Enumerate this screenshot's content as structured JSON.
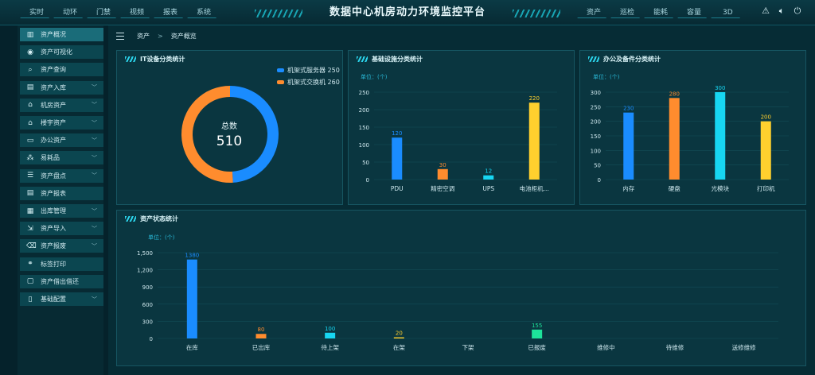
{
  "header": {
    "title": "数据中心机房动力环境监控平台",
    "nav_left": [
      "实时",
      "动环",
      "门禁",
      "视频",
      "报表",
      "系统"
    ],
    "nav_right": [
      "资产",
      "巡检",
      "能耗",
      "容量",
      "3D"
    ]
  },
  "sidebar": {
    "items": [
      {
        "label": "资产概况",
        "icon": "chart-bar-icon",
        "expandable": false,
        "active": true
      },
      {
        "label": "资产可视化",
        "icon": "eye-icon",
        "expandable": false
      },
      {
        "label": "资产查询",
        "icon": "search-icon",
        "expandable": false
      },
      {
        "label": "资产入库",
        "icon": "doc-icon",
        "expandable": true
      },
      {
        "label": "机房资产",
        "icon": "building-icon",
        "expandable": true
      },
      {
        "label": "楼宇资产",
        "icon": "building-icon",
        "expandable": true
      },
      {
        "label": "办公资产",
        "icon": "monitor-icon",
        "expandable": true
      },
      {
        "label": "易耗品",
        "icon": "nodes-icon",
        "expandable": true
      },
      {
        "label": "资产盘点",
        "icon": "list-icon",
        "expandable": true
      },
      {
        "label": "资产报表",
        "icon": "doc-icon",
        "expandable": false
      },
      {
        "label": "出库管理",
        "icon": "calendar-icon",
        "expandable": true
      },
      {
        "label": "资产导入",
        "icon": "import-icon",
        "expandable": true
      },
      {
        "label": "资产报废",
        "icon": "trash-icon",
        "expandable": true
      },
      {
        "label": "标签打印",
        "icon": "link-icon",
        "expandable": false
      },
      {
        "label": "资产借出借还",
        "icon": "chat-icon",
        "expandable": false
      },
      {
        "label": "基础配置",
        "icon": "book-icon",
        "expandable": true
      }
    ]
  },
  "breadcrumb": {
    "root": "资产",
    "sep": ">",
    "current": "资产概览"
  },
  "panels": {
    "it": {
      "title": "IT设备分类统计"
    },
    "infra": {
      "title": "基础设施分类统计",
      "unit": "单位：(个)"
    },
    "office": {
      "title": "办公及备件分类统计",
      "unit": "单位：(个)"
    },
    "status": {
      "title": "资产状态统计",
      "unit": "单位：(个)"
    }
  },
  "donut": {
    "center_label": "总数",
    "center_value": "510",
    "legend": [
      "机架式服务器 250",
      "机架式交换机 260"
    ]
  },
  "colors": {
    "blue": "#1a8cff",
    "orange": "#ff8c2e",
    "cyan": "#17d6f2",
    "yellow": "#ffd02e",
    "green": "#1de39a"
  },
  "chart_data": [
    {
      "type": "pie",
      "title": "IT设备分类统计",
      "categories": [
        "机架式服务器",
        "机架式交换机"
      ],
      "values": [
        250,
        260
      ],
      "colors": [
        "#1a8cff",
        "#ff8c2e"
      ]
    },
    {
      "type": "bar",
      "title": "基础设施分类统计",
      "categories": [
        "PDU",
        "精密空调",
        "UPS",
        "电池柜机..."
      ],
      "values": [
        120,
        30,
        12,
        220
      ],
      "colors": [
        "#1a8cff",
        "#ff8c2e",
        "#17d6f2",
        "#ffd02e"
      ],
      "ylim": [
        0,
        250
      ],
      "yticks": [
        0,
        50,
        100,
        150,
        200,
        250
      ]
    },
    {
      "type": "bar",
      "title": "办公及备件分类统计",
      "categories": [
        "内存",
        "硬盘",
        "光模块",
        "打印机"
      ],
      "values": [
        230,
        280,
        300,
        200
      ],
      "colors": [
        "#1a8cff",
        "#ff8c2e",
        "#17d6f2",
        "#ffd02e"
      ],
      "ylim": [
        0,
        300
      ],
      "yticks": [
        0,
        50,
        100,
        150,
        200,
        250,
        300
      ]
    },
    {
      "type": "bar",
      "title": "资产状态统计",
      "categories": [
        "在库",
        "已出库",
        "待上架",
        "在架",
        "下架",
        "已报废",
        "维修中",
        "待维修",
        "送修维修"
      ],
      "values": [
        1380,
        80,
        100,
        20,
        0,
        155,
        0,
        0,
        0
      ],
      "labels": [
        "1380",
        "80",
        "100",
        "20",
        "",
        "155",
        "",
        "",
        ""
      ],
      "colors": [
        "#1a8cff",
        "#ff8c2e",
        "#17d6f2",
        "#ffd02e",
        "#1a8cff",
        "#1de39a",
        "#1a8cff",
        "#1a8cff",
        "#1a8cff"
      ],
      "ylim": [
        0,
        1500
      ],
      "yticks": [
        "0",
        "300",
        "600",
        "900",
        "1,200",
        "1,500"
      ]
    }
  ]
}
